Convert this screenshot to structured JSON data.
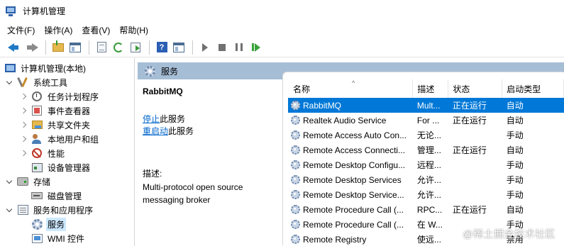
{
  "window": {
    "title": "计算机管理"
  },
  "menu": [
    "文件(F)",
    "操作(A)",
    "查看(V)",
    "帮助(H)"
  ],
  "toolbar": {
    "icons": [
      "back-icon",
      "forward-icon",
      "up-folder-icon",
      "show-hide-tree-icon",
      "properties-icon",
      "refresh-icon",
      "export-list-icon",
      "help-icon",
      "show-action-pane-icon",
      "start-service-icon",
      "stop-service-icon",
      "pause-service-icon",
      "resume-service-icon"
    ]
  },
  "tree": {
    "root": "计算机管理(本地)",
    "system_tools": "系统工具",
    "task_scheduler": "任务计划程序",
    "event_viewer": "事件查看器",
    "shared_folders": "共享文件夹",
    "local_users": "本地用户和组",
    "performance": "性能",
    "device_manager": "设备管理器",
    "storage": "存储",
    "disk_management": "磁盘管理",
    "services_apps": "服务和应用程序",
    "services": "服务",
    "wmi": "WMI 控件"
  },
  "services_pane": {
    "header": "服务",
    "selected_name": "RabbitMQ",
    "stop_link": "停止",
    "stop_suffix": "此服务",
    "restart_link": "重启动",
    "restart_suffix": "此服务",
    "desc_label": "描述:",
    "desc_line1": "Multi-protocol open source",
    "desc_line2": "messaging broker"
  },
  "table": {
    "columns": {
      "name": "名称",
      "desc": "描述",
      "status": "状态",
      "startup": "启动类型"
    },
    "rows": [
      {
        "name": "RabbitMQ",
        "desc": "Mult...",
        "status": "正在运行",
        "startup": "自动",
        "selected": true
      },
      {
        "name": "Realtek Audio Service",
        "desc": "For ...",
        "status": "正在运行",
        "startup": "自动"
      },
      {
        "name": "Remote Access Auto Con...",
        "desc": "无论...",
        "status": "",
        "startup": "手动"
      },
      {
        "name": "Remote Access Connecti...",
        "desc": "管理...",
        "status": "正在运行",
        "startup": "自动"
      },
      {
        "name": "Remote Desktop Configu...",
        "desc": "远程...",
        "status": "",
        "startup": "手动"
      },
      {
        "name": "Remote Desktop Services",
        "desc": "允许...",
        "status": "",
        "startup": "手动"
      },
      {
        "name": "Remote Desktop Service...",
        "desc": "允许...",
        "status": "",
        "startup": "手动"
      },
      {
        "name": "Remote Procedure Call (...",
        "desc": "RPC...",
        "status": "正在运行",
        "startup": "自动"
      },
      {
        "name": "Remote Procedure Call (...",
        "desc": "在 W...",
        "status": "",
        "startup": "手动"
      },
      {
        "name": "Remote Registry",
        "desc": "使远...",
        "status": "",
        "startup": "禁用"
      }
    ]
  },
  "watermark": "@稀土掘金技术社区"
}
